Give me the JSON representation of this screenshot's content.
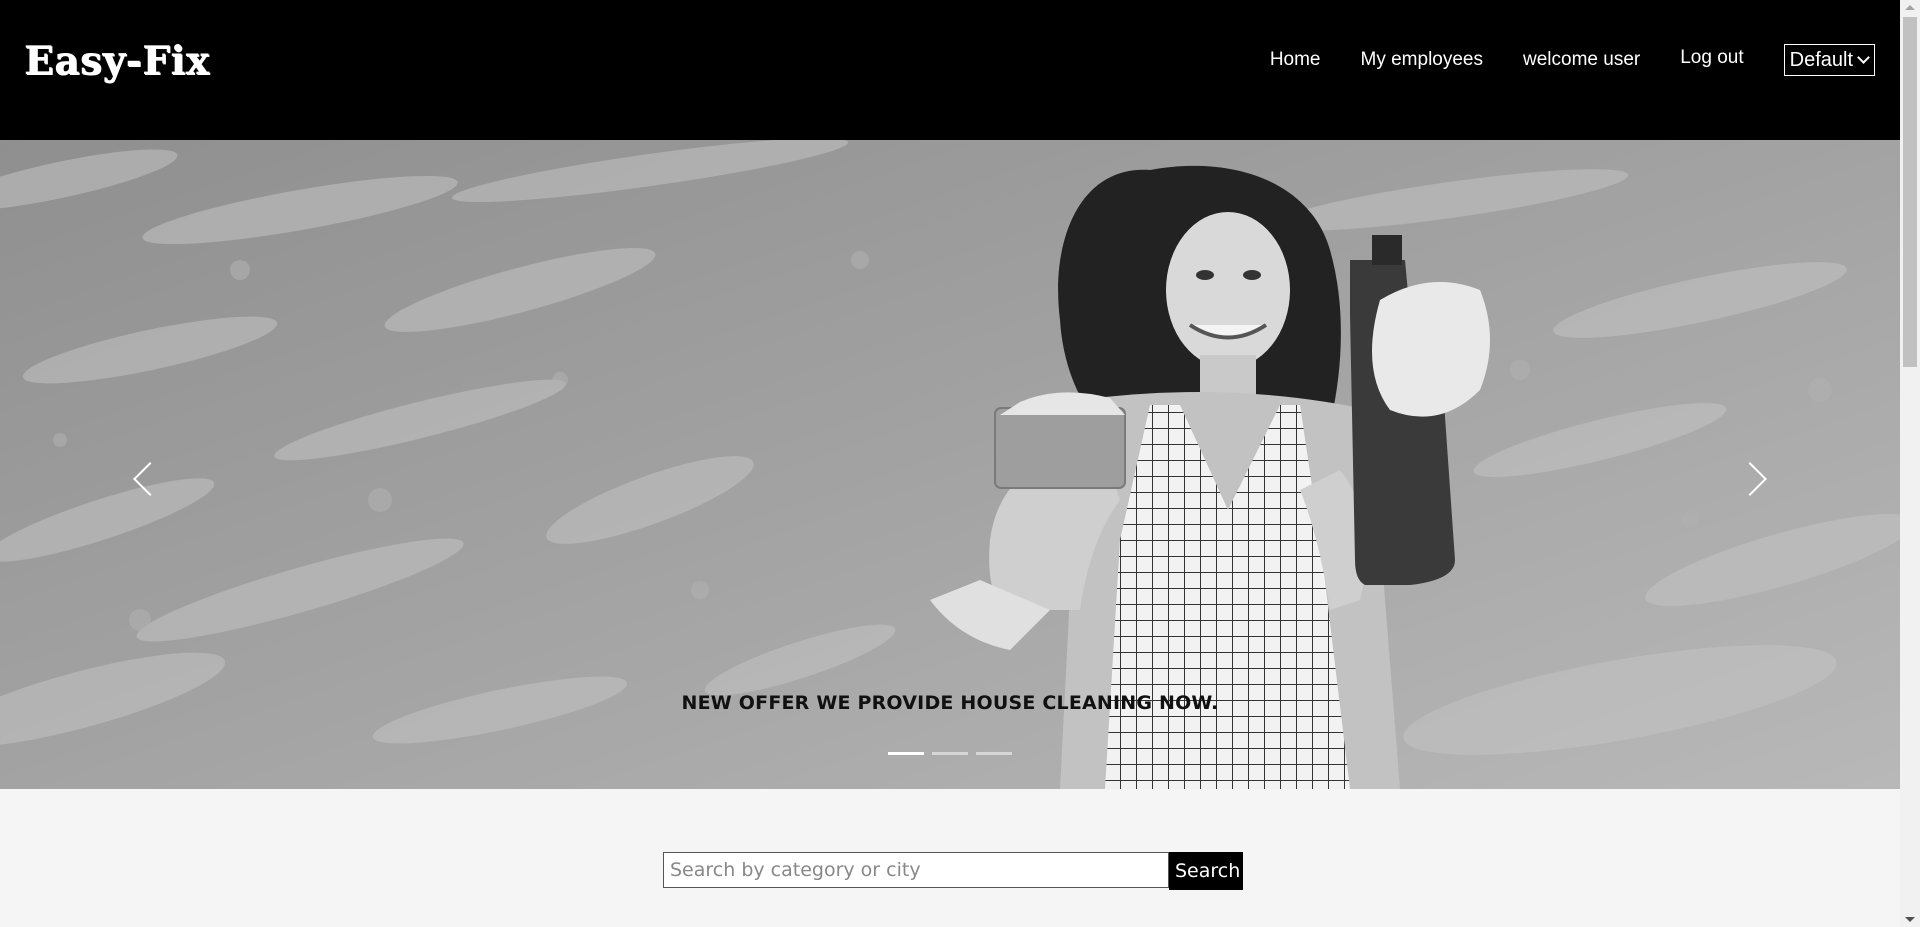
{
  "brand": {
    "name": "Easy-Fix"
  },
  "nav": {
    "home": "Home",
    "employees": "My employees",
    "welcome": "welcome user",
    "logout": "Log out",
    "language": "Default"
  },
  "hero": {
    "caption": "NEW OFFER WE PROVIDE HOUSE CLEANING NOW.",
    "slides_total": 3,
    "active_slide": 1
  },
  "search": {
    "placeholder": "Search by category or city",
    "value": "",
    "button": "Search"
  },
  "colors": {
    "header_bg": "#000000",
    "page_bg": "#f4f5f4",
    "hero_tone": "grayscale"
  }
}
